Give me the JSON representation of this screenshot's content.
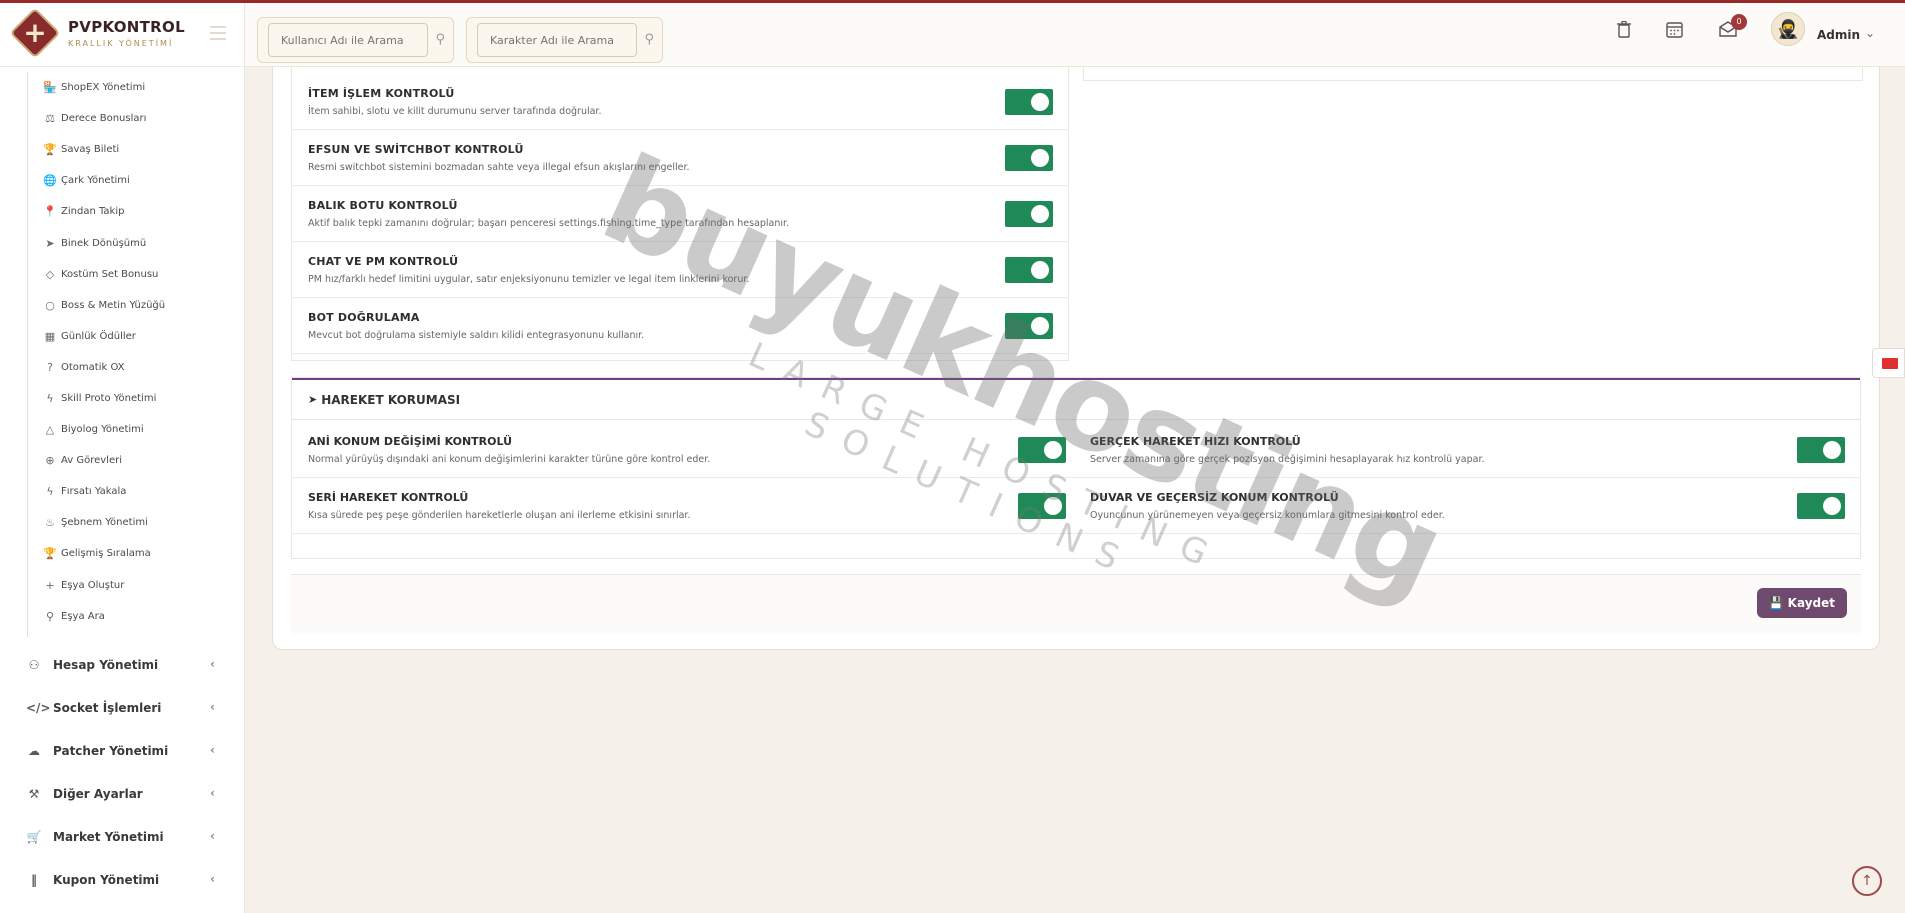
{
  "brand": {
    "name": "PVPKONTROL",
    "subtitle": "KRALLIK YÖNETİMİ"
  },
  "header": {
    "search_user_placeholder": "Kullanıcı Adı ile Arama",
    "search_char_placeholder": "Karakter Adı ile Arama",
    "notification_count": "0",
    "user_name": "Admin"
  },
  "sidebar": {
    "subitems": [
      {
        "label": "ShopEX Yönetimi",
        "icon": "shop-icon"
      },
      {
        "label": "Derece Bonusları",
        "icon": "scale-icon"
      },
      {
        "label": "Savaş Bileti",
        "icon": "trophy-icon"
      },
      {
        "label": "Çark Yönetimi",
        "icon": "globe-icon"
      },
      {
        "label": "Zindan Takip",
        "icon": "pin-icon"
      },
      {
        "label": "Binek Dönüşümü",
        "icon": "rocket-icon"
      },
      {
        "label": "Kostüm Set Bonusu",
        "icon": "gem-icon"
      },
      {
        "label": "Boss & Metin Yüzüğü",
        "icon": "circle-icon"
      },
      {
        "label": "Günlük Ödüller",
        "icon": "calendar-icon"
      },
      {
        "label": "Otomatik OX",
        "icon": "question-icon"
      },
      {
        "label": "Skill Proto Yönetimi",
        "icon": "bolt-icon"
      },
      {
        "label": "Biyolog Yönetimi",
        "icon": "flask-icon"
      },
      {
        "label": "Av Görevleri",
        "icon": "crosshair-icon"
      },
      {
        "label": "Fırsatı Yakala",
        "icon": "bolt-icon"
      },
      {
        "label": "Şebnem Yönetimi",
        "icon": "fire-icon"
      },
      {
        "label": "Gelişmiş Sıralama",
        "icon": "trophy-icon"
      },
      {
        "label": "Eşya Oluştur",
        "icon": "plus-icon"
      },
      {
        "label": "Eşya Ara",
        "icon": "search-icon"
      }
    ],
    "nav": [
      {
        "label": "Hesap Yönetimi",
        "icon": "users-icon"
      },
      {
        "label": "Socket İşlemleri",
        "icon": "code-icon"
      },
      {
        "label": "Patcher Yönetimi",
        "icon": "cloud-download-icon"
      },
      {
        "label": "Diğer Ayarlar",
        "icon": "wrench-icon"
      },
      {
        "label": "Market Yönetimi",
        "icon": "cart-icon"
      },
      {
        "label": "Kupon Yönetimi",
        "icon": "barcode-icon"
      }
    ]
  },
  "controls_left": [
    {
      "title": "İTEM İŞLEM KONTROLÜ",
      "desc": "İtem sahibi, slotu ve kilit durumunu server tarafında doğrular.",
      "enabled": true
    },
    {
      "title": "EFSUN VE SWİTCHBOT KONTROLÜ",
      "desc": "Resmi switchbot sistemini bozmadan sahte veya illegal efsun akışlarını engeller.",
      "enabled": true
    },
    {
      "title": "BALIK BOTU KONTROLÜ",
      "desc": "Aktif balık tepki zamanını doğrular; başarı penceresi settings.fishing.time_type tarafından hesaplanır.",
      "enabled": true
    },
    {
      "title": "CHAT VE PM KONTROLÜ",
      "desc": "PM hız/farklı hedef limitini uygular, satır enjeksiyonunu temizler ve legal item linklerini korur.",
      "enabled": true
    },
    {
      "title": "BOT DOĞRULAMA",
      "desc": "Mevcut bot doğrulama sistemiyle saldırı kilidi entegrasyonunu kullanır.",
      "enabled": true
    }
  ],
  "hareket": {
    "title": "HAREKET KORUMASI",
    "items": [
      {
        "title": "ANİ KONUM DEĞİŞİMİ KONTROLÜ",
        "desc": "Normal yürüyüş dışındaki ani konum değişimlerini karakter türüne göre kontrol eder.",
        "enabled": true
      },
      {
        "title": "GERÇEK HAREKET HIZI KONTROLÜ",
        "desc": "Server zamanına göre gerçek pozisyon değişimini hesaplayarak hız kontrolü yapar.",
        "enabled": true
      },
      {
        "title": "SERİ HAREKET KONTROLÜ",
        "desc": "Kısa sürede peş peşe gönderilen hareketlerle oluşan ani ilerleme etkisini sınırlar.",
        "enabled": true
      },
      {
        "title": "DUVAR VE GEÇERSİZ KONUM KONTROLÜ",
        "desc": "Oyuncunun yürünemeyen veya geçersiz konumlara gitmesini kontrol eder.",
        "enabled": true
      }
    ]
  },
  "save_label": "Kaydet",
  "watermark": {
    "main": "buyukhosting",
    "sub": "LARGE HOSTING SOLUTIONS"
  },
  "colors": {
    "toggle_on": "#1f8a58",
    "accent_purple": "#6c3f86",
    "brand_red": "#8a2b2b"
  }
}
